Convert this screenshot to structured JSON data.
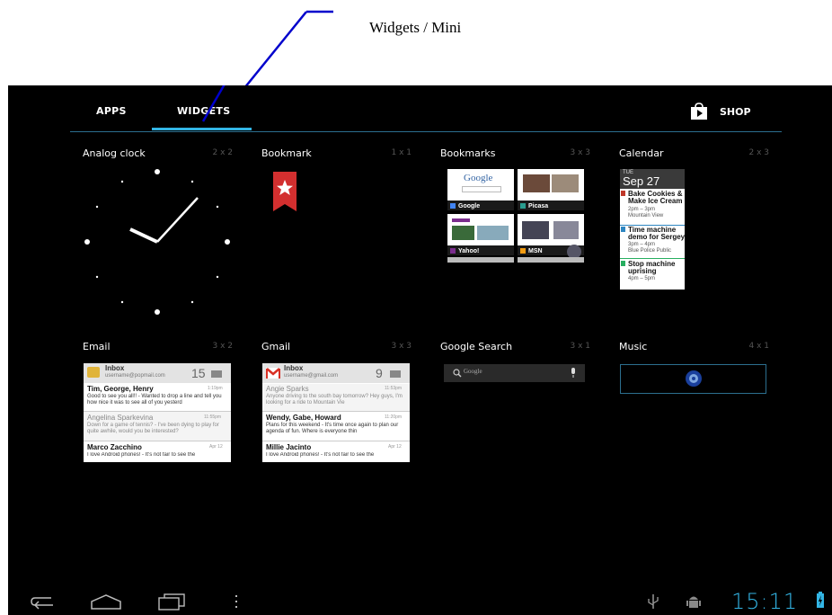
{
  "annotation": {
    "text": "Widgets / Mini"
  },
  "tabs": [
    {
      "label": "APPS"
    },
    {
      "label": "WIDGETS"
    }
  ],
  "shop": {
    "label": "SHOP"
  },
  "widgets": [
    {
      "name": "Analog clock",
      "size": "2 x 2"
    },
    {
      "name": "Bookmark",
      "size": "1 x 1"
    },
    {
      "name": "Bookmarks",
      "size": "3 x 3"
    },
    {
      "name": "Calendar",
      "size": "2 x 3"
    },
    {
      "name": "Email",
      "size": "3 x 2"
    },
    {
      "name": "Gmail",
      "size": "3 x 3"
    },
    {
      "name": "Google Search",
      "size": "3 x 1"
    },
    {
      "name": "Music",
      "size": "4 x 1"
    }
  ],
  "bookmarks_preview": [
    "Google",
    "Picasa",
    "Yahoo!",
    "MSN"
  ],
  "bookmarks_google_logo": "Google",
  "calendar_preview": {
    "day": "TUE",
    "date": "Sep 27",
    "events": [
      {
        "title": "Bake Cookies & Make Ice Cream",
        "time": "2pm – 3pm",
        "place": "Mountain View",
        "color": "#c0392b"
      },
      {
        "title": "Time machine demo for Sergey",
        "time": "3pm – 4pm",
        "place": "Blue Police Public",
        "color": "#2e86c1"
      },
      {
        "title": "Stop machine uprising",
        "time": "4pm – 5pm",
        "place": "",
        "color": "#27ae60"
      }
    ]
  },
  "email_preview": {
    "header": "Inbox",
    "account": "username@popmail.com",
    "count": "15",
    "messages": [
      {
        "from": "Tim, George, Henry",
        "time": "1:19pm",
        "snippet": "Good to see you all!! - Wanted to drop a line and tell you how nice it was to see all of you yesterd"
      },
      {
        "from": "Angelina Sparkevina",
        "time": "11:55pm",
        "snippet": "Down for a game of tennis? - I've been dying to play for quite awhile, would you be interested?"
      },
      {
        "from": "Marco Zacchino",
        "time": "Apr 12",
        "snippet": "I love Android phones! - It's not fair to see the"
      }
    ]
  },
  "gmail_preview": {
    "header": "Inbox",
    "account": "username@gmail.com",
    "count": "9",
    "messages": [
      {
        "from": "Angie Sparks",
        "time": "11:53pm",
        "snippet": "Anyone driving to the south bay tomorrow? Hey guys, I'm looking for a ride to Mountain Vie"
      },
      {
        "from": "Wendy, Gabe, Howard",
        "time": "11:20pm",
        "snippet": "Plans for this weekend - It's time once again to plan our agenda of fun. Where is everyone thin"
      },
      {
        "from": "Millie Jacinto",
        "time": "Apr 12",
        "snippet": "I love Android phones! - It's not fair to see the"
      }
    ]
  },
  "search_preview": {
    "placeholder": "Google"
  },
  "status": {
    "time": "15:11"
  },
  "colors": {
    "accent": "#33b5e5",
    "bookmark_red": "#d32f2f",
    "annotation_arrow": "#0000cc"
  },
  "icons": [
    "back-icon",
    "home-icon",
    "recent-apps-icon",
    "menu-icon",
    "usb-icon",
    "android-debug-icon",
    "battery-icon",
    "shop-bag-icon",
    "star-icon",
    "search-icon",
    "mic-icon"
  ]
}
